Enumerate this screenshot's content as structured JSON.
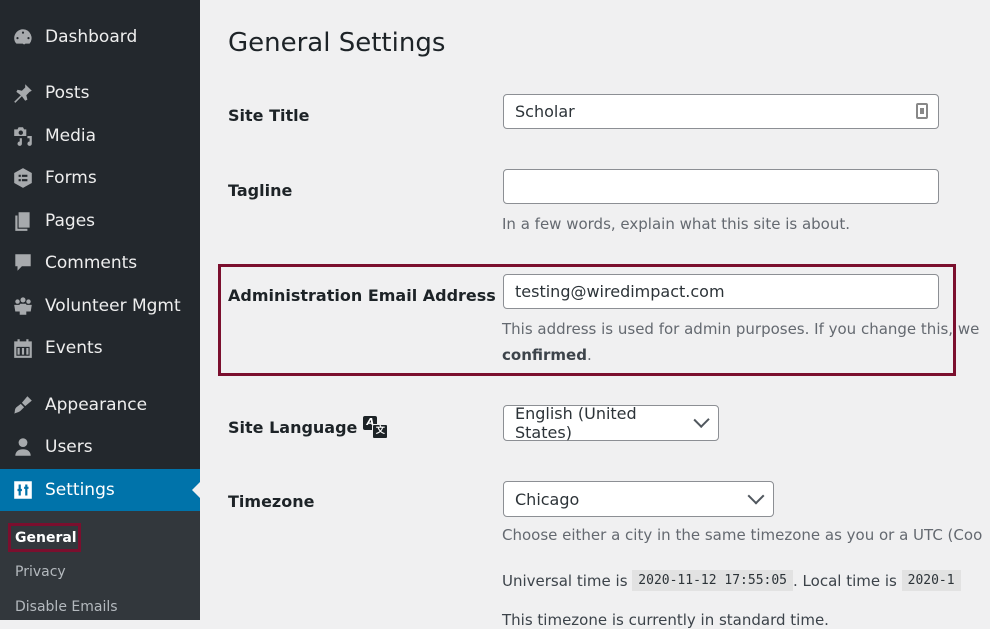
{
  "sidebar": {
    "items": [
      {
        "label": "Dashboard",
        "icon": "dashboard-icon"
      },
      {
        "label": "Posts",
        "icon": "pin-icon"
      },
      {
        "label": "Media",
        "icon": "media-icon"
      },
      {
        "label": "Forms",
        "icon": "forms-icon"
      },
      {
        "label": "Pages",
        "icon": "pages-icon"
      },
      {
        "label": "Comments",
        "icon": "comment-icon"
      },
      {
        "label": "Volunteer Mgmt",
        "icon": "groups-icon"
      },
      {
        "label": "Events",
        "icon": "calendar-icon"
      },
      {
        "label": "Appearance",
        "icon": "brush-icon"
      },
      {
        "label": "Users",
        "icon": "user-icon"
      },
      {
        "label": "Settings",
        "icon": "settings-icon",
        "active": true
      }
    ],
    "submenu": [
      {
        "label": "General",
        "current": true
      },
      {
        "label": "Privacy"
      },
      {
        "label": "Disable Emails"
      }
    ]
  },
  "main": {
    "title": "General Settings",
    "site_title": {
      "label": "Site Title",
      "value": "Scholar"
    },
    "tagline": {
      "label": "Tagline",
      "value": "",
      "description": "In a few words, explain what this site is about."
    },
    "admin_email": {
      "label": "Administration Email Address",
      "value": "testing@wiredimpact.com",
      "description": "This address is used for admin purposes. If you change this, we",
      "description_bold": "confirmed",
      "description_end": "."
    },
    "site_language": {
      "label": "Site Language",
      "value": "English (United States)"
    },
    "timezone": {
      "label": "Timezone",
      "value": "Chicago",
      "description": "Choose either a city in the same timezone as you or a UTC (Coo",
      "universal_prefix": "Universal time is",
      "universal_time": "2020-11-12 17:55:05",
      "local_prefix": ". Local time is",
      "local_time": "2020-1",
      "standard_note": "This timezone is currently in standard time."
    }
  },
  "colors": {
    "sidebar_bg": "#23282d",
    "accent": "#0073aa",
    "highlight_border": "#7b0f2e"
  }
}
